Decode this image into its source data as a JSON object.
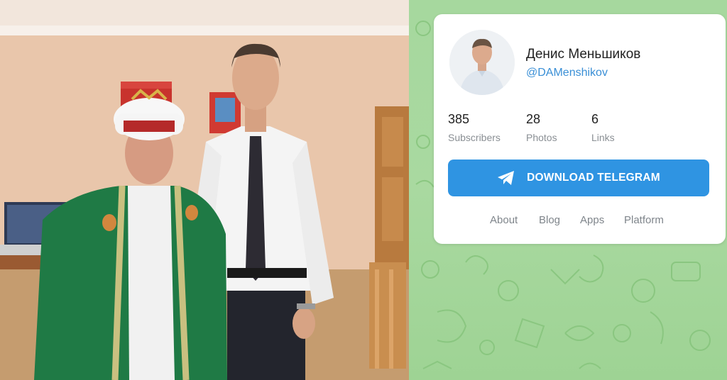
{
  "profile": {
    "name": "Денис Меньшиков",
    "handle": "@DAMenshikov"
  },
  "stats": [
    {
      "value": "385",
      "label": "Subscribers"
    },
    {
      "value": "28",
      "label": "Photos"
    },
    {
      "value": "6",
      "label": "Links"
    }
  ],
  "download_button": {
    "label": "DOWNLOAD TELEGRAM",
    "icon": "telegram-plane-icon"
  },
  "footer_links": [
    "About",
    "Blog",
    "Apps",
    "Platform"
  ],
  "colors": {
    "accent": "#2f94e2",
    "link": "#3a8fd6",
    "pattern_background": "#a6d89e"
  }
}
